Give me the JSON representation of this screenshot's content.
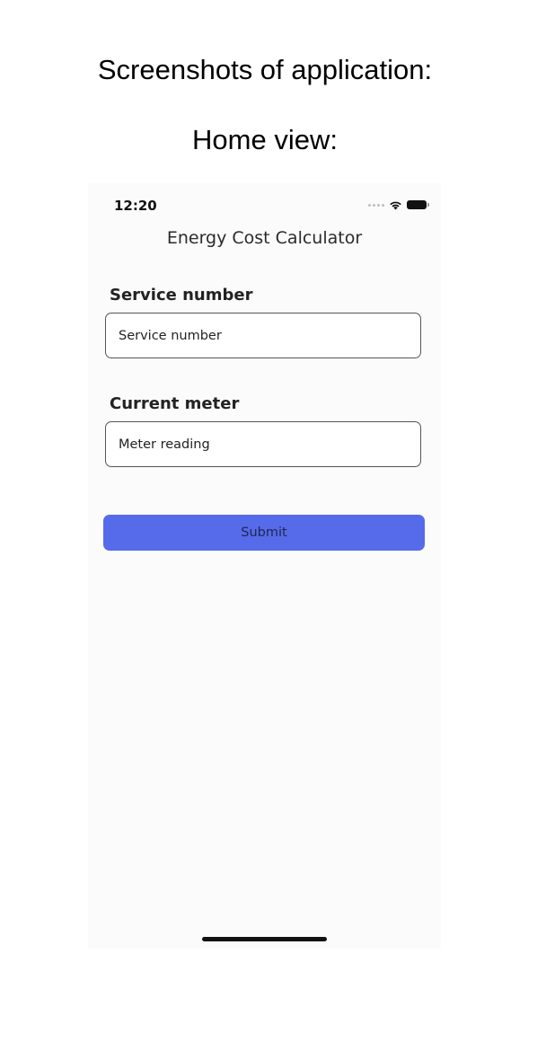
{
  "document": {
    "heading": "Screenshots of application:",
    "subheading": "Home view:"
  },
  "status_bar": {
    "time": "12:20",
    "icons": [
      "cellular-signal-icon",
      "wifi-icon",
      "battery-icon"
    ]
  },
  "app": {
    "title": "Energy Cost Calculator",
    "service_field": {
      "label": "Service number",
      "placeholder": "Service number",
      "value": ""
    },
    "meter_field": {
      "label": "Current meter",
      "placeholder": "Meter reading",
      "value": ""
    },
    "submit_label": "Submit"
  },
  "colors": {
    "accent": "#566be9",
    "screen_background": "#fbfbfb",
    "field_border": "#555555"
  }
}
